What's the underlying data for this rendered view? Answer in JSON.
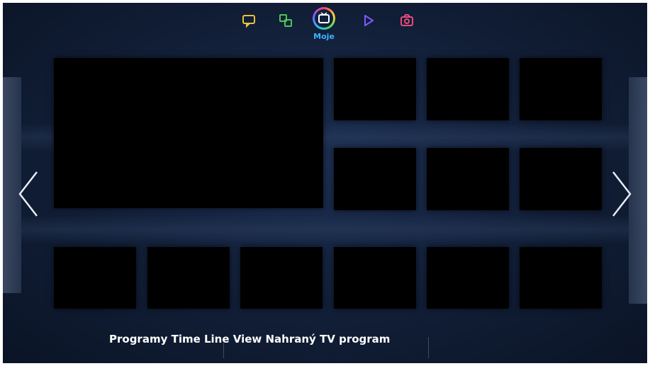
{
  "tabs": [
    {
      "icon": "chat-bubble-icon",
      "color": "#e8c23a"
    },
    {
      "icon": "apps-icon",
      "color": "#4cc45a"
    },
    {
      "icon": "tv-icon",
      "color": "#3cb4ff",
      "label": "Moje",
      "active": true
    },
    {
      "icon": "play-icon",
      "color": "#7a5cff"
    },
    {
      "icon": "camera-icon",
      "color": "#e84a7a"
    }
  ],
  "caption": "Programy Time Line View Nahraný TV program",
  "nav": {
    "left": "chevron-left-icon",
    "right": "chevron-right-icon"
  },
  "colors": {
    "background": "#111e36",
    "tile": "#000000",
    "active_label": "#3cb4ff"
  }
}
